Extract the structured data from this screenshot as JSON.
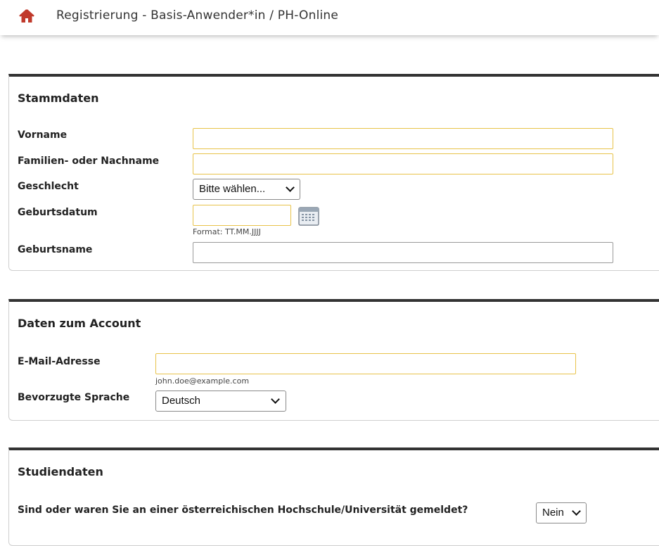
{
  "header": {
    "title": "Registrierung - Basis-Anwender*in / PH-Online",
    "home_icon": "home-icon",
    "accent_color": "#c0392b"
  },
  "stammdaten": {
    "title": "Stammdaten",
    "vorname_label": "Vorname",
    "nachname_label": "Familien- oder Nachname",
    "geschlecht_label": "Geschlecht",
    "geschlecht_value": "Bitte wählen...",
    "geburtsdatum_label": "Geburtsdatum",
    "geburtsdatum_hint": "Format: TT.MM.JJJJ",
    "calendar_icon": "calendar-icon",
    "geburtsname_label": "Geburtsname"
  },
  "account": {
    "title": "Daten zum Account",
    "email_label": "E-Mail-Adresse",
    "email_hint": "john.doe@example.com",
    "sprache_label": "Bevorzugte Sprache",
    "sprache_value": "Deutsch"
  },
  "studien": {
    "title": "Studiendaten",
    "question_label": "Sind oder waren Sie an einer österreichischen Hochschule/Universität gemeldet?",
    "question_value": "Nein"
  }
}
